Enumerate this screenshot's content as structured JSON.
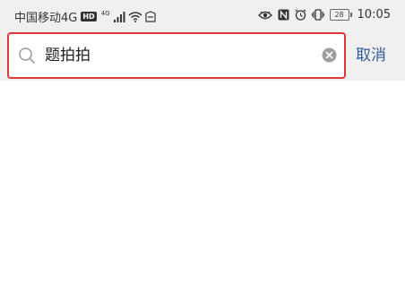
{
  "status_bar": {
    "carrier": "中国移动4G",
    "hd_badge": "HD",
    "network_type": "4G",
    "battery_level": "28",
    "time": "10:05",
    "left_icons": [
      "hd-icon",
      "signal-icon",
      "wifi-icon",
      "notification-icon"
    ],
    "right_icons": [
      "eye-icon",
      "nfc-icon",
      "alarm-icon",
      "vibrate-icon",
      "battery-icon"
    ]
  },
  "search": {
    "query": "题拍拍",
    "icon": "search-icon",
    "clear_icon": "clear-icon"
  },
  "actions": {
    "cancel_label": "取消"
  },
  "colors": {
    "highlight_border": "#e0363a",
    "link": "#2f5b9c",
    "bar_background": "#f0f0f0"
  }
}
